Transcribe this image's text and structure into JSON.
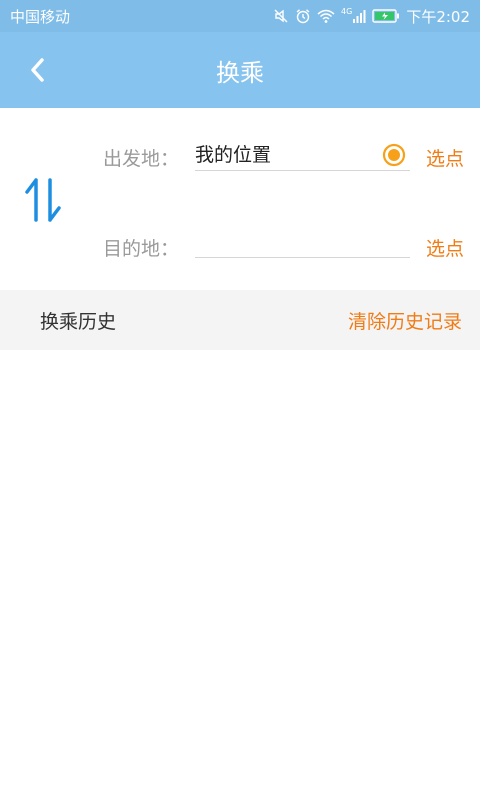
{
  "status_bar": {
    "carrier": "中国移动",
    "network_badge": "4G",
    "time": "下午2:02",
    "icons": [
      "mute-icon",
      "alarm-icon",
      "wifi-icon",
      "signal-icon",
      "battery-charging-icon"
    ]
  },
  "header": {
    "title": "换乘",
    "back_icon": "back-chevron-icon"
  },
  "form": {
    "origin_label": "出发地：",
    "origin_value": "我的位置",
    "origin_pick": "选点",
    "destination_label": "目的地：",
    "destination_value": "",
    "destination_pick": "选点",
    "swap_icon": "swap-arrows-icon",
    "location_icon": "my-location-icon"
  },
  "history": {
    "title": "换乘历史",
    "clear": "清除历史记录"
  },
  "colors": {
    "statusbar": "#7fbde8",
    "appbar": "#86c3ee",
    "accent_orange": "#f07c16",
    "swap_blue": "#1e8fe0"
  }
}
